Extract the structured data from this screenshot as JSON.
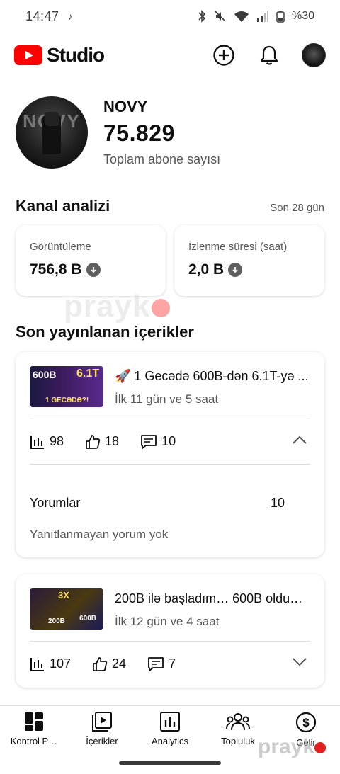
{
  "statusbar": {
    "time": "14:47",
    "battery": "%30"
  },
  "app": {
    "brand": "Studio"
  },
  "channel": {
    "name": "NOVY",
    "subscribers": "75.829",
    "subscribers_label": "Toplam abone sayısı",
    "avatar_text": "NOVY"
  },
  "analytics": {
    "title": "Kanal analizi",
    "period": "Son 28 gün",
    "views": {
      "label": "Görüntüleme",
      "value": "756,8 B"
    },
    "watch": {
      "label": "İzlenme süresi (saat)",
      "value": "2,0 B"
    }
  },
  "recent": {
    "title": "Son yayınlanan içerikler",
    "items": [
      {
        "title": "🚀 1 Gecədə 600B-dən 6.1T-yə ...",
        "age": "İlk 11 gün ve 5 saat",
        "views": "98",
        "likes": "18",
        "comments": "10",
        "comments_label": "Yorumlar",
        "comments_count": "10",
        "no_unreplied": "Yanıtlanmayan yorum yok",
        "thumb_a": "600B",
        "thumb_b": "6.1T",
        "thumb_c": "1 GECƏDƏ?!"
      },
      {
        "title": " 200B ilə başladım… 600B oldu…",
        "age": "İlk 12 gün ve 4 saat",
        "views": "107",
        "likes": "24",
        "comments": "7",
        "thumb_a": "3X",
        "thumb_b": "200B",
        "thumb_c": "600B"
      }
    ]
  },
  "nav": [
    {
      "label": "Kontrol P…",
      "icon": "dashboard-icon"
    },
    {
      "label": "İçerikler",
      "icon": "content-icon"
    },
    {
      "label": "Analytics",
      "icon": "analytics-icon"
    },
    {
      "label": "Topluluk",
      "icon": "community-icon"
    },
    {
      "label": "Gelir",
      "icon": "earn-icon"
    }
  ],
  "watermark": "prayk"
}
